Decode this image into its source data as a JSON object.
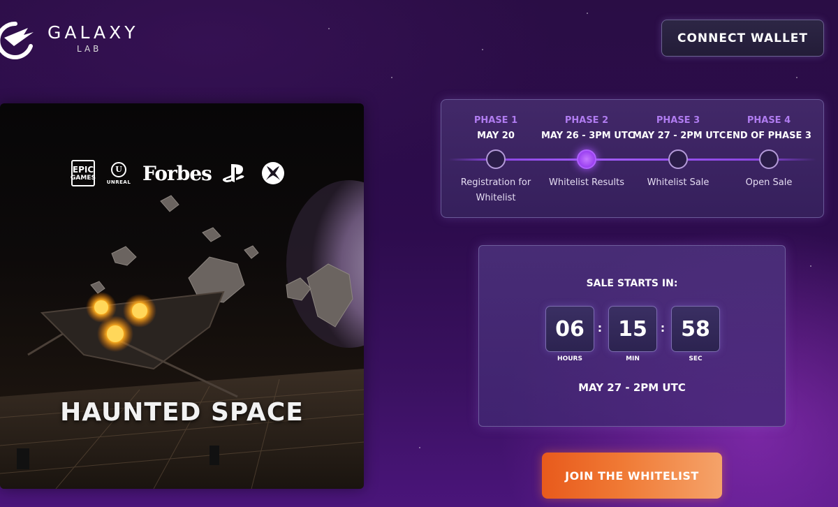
{
  "brand": {
    "title": "GALAXY",
    "subtitle": "LAB"
  },
  "header": {
    "connect_wallet_label": "CONNECT WALLET"
  },
  "game": {
    "title": "HAUNTED SPACE",
    "partners": {
      "epic_line1": "EPIC",
      "epic_line2": "GAMES",
      "unreal_label": "UNREAL",
      "forbes": "Forbes"
    }
  },
  "phases": [
    {
      "name": "PHASE 1",
      "date": "MAY 20",
      "description": "Registration for Whitelist",
      "active": false
    },
    {
      "name": "PHASE 2",
      "date": "MAY 26 - 3PM UTC",
      "description": "Whitelist Results",
      "active": true
    },
    {
      "name": "PHASE 3",
      "date": "MAY 27 - 2PM UTC",
      "description": "Whitelist Sale",
      "active": false
    },
    {
      "name": "PHASE 4",
      "date": "END OF PHASE 3",
      "description": "Open Sale",
      "active": false
    }
  ],
  "countdown": {
    "label": "SALE STARTS IN:",
    "hours": "06",
    "minutes": "15",
    "seconds": "58",
    "hours_unit": "HOURS",
    "minutes_unit": "MIN",
    "seconds_unit": "SEC",
    "separator": ":",
    "date": "MAY 27 - 2PM UTC"
  },
  "cta": {
    "join_label": "JOIN THE WHITELIST"
  },
  "colors": {
    "accent_purple": "#a35cff",
    "phase_label": "#b07cf0",
    "cta_orange": "#f07a35"
  }
}
